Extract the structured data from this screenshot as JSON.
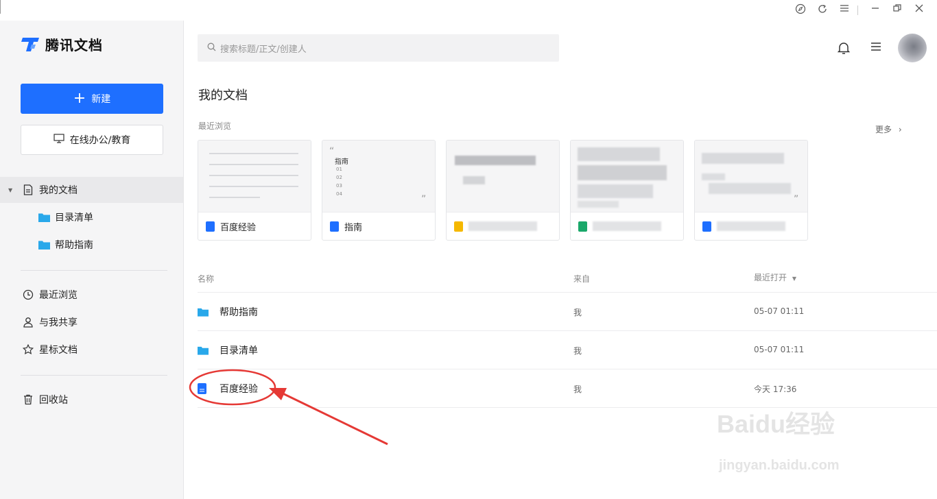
{
  "app": {
    "brand": "腾讯文档"
  },
  "sidebar": {
    "new_button": "新建",
    "online_button": "在线办公/教育",
    "nav": [
      {
        "label": "我的文档",
        "icon": "document-icon",
        "active": true
      },
      {
        "label": "目录清单",
        "icon": "folder-icon"
      },
      {
        "label": "帮助指南",
        "icon": "folder-icon"
      },
      {
        "label": "最近浏览",
        "icon": "clock-icon"
      },
      {
        "label": "与我共享",
        "icon": "user-icon"
      },
      {
        "label": "星标文档",
        "icon": "star-icon"
      },
      {
        "label": "回收站",
        "icon": "trash-icon"
      }
    ]
  },
  "header": {
    "search_placeholder": "搜索标题/正文/创建人"
  },
  "main": {
    "title": "我的文档",
    "recent_label": "最近浏览",
    "more_label": "更多",
    "cards": [
      {
        "name": "百度经验",
        "type": "doc"
      },
      {
        "name": "指南",
        "type": "doc",
        "preview_title": "指南",
        "preview_items": [
          "01",
          "02",
          "03",
          "04"
        ]
      },
      {
        "name": "",
        "type": "sheet-yellow"
      },
      {
        "name": "",
        "type": "sheet-green"
      },
      {
        "name": "",
        "type": "doc"
      }
    ],
    "columns": {
      "name": "名称",
      "from": "来自",
      "time": "最近打开"
    },
    "rows": [
      {
        "name": "帮助指南",
        "type": "folder",
        "from": "我",
        "time": "05-07 01:11"
      },
      {
        "name": "目录清单",
        "type": "folder",
        "from": "我",
        "time": "05-07 01:11"
      },
      {
        "name": "百度经验",
        "type": "doc",
        "from": "我",
        "time": "今天 17:36"
      }
    ]
  },
  "watermark": {
    "line1": "Baidu经验",
    "line2": "jingyan.baidu.com"
  },
  "colors": {
    "accent": "#1e6fff",
    "folder": "#29a8ea",
    "annotation": "#e53935"
  }
}
